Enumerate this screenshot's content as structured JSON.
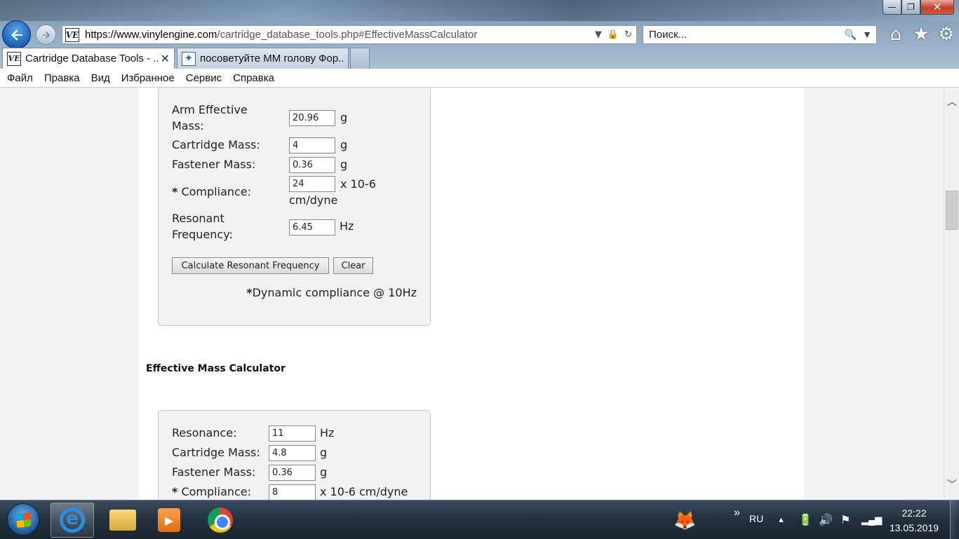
{
  "browser": {
    "url_host": "https://www.vinylengine.com",
    "url_path": "/cartridge_database_tools.php#EffectiveMassCalculator",
    "search_placeholder": "Поиск...",
    "tabs": [
      {
        "title": "Cartridge Database Tools - ..."
      },
      {
        "title": "посоветуйте ММ голову Фор..."
      }
    ],
    "menu": [
      "Файл",
      "Правка",
      "Вид",
      "Избранное",
      "Сервис",
      "Справка"
    ]
  },
  "resonance_calc": {
    "arm_mass_label": "Arm Effective Mass:",
    "arm_mass_value": "20.96",
    "arm_mass_unit": "g",
    "cart_mass_label": "Cartridge Mass:",
    "cart_mass_value": "4",
    "cart_mass_unit": "g",
    "fastener_label": "Fastener Mass:",
    "fastener_value": "0.36",
    "fastener_unit": "g",
    "compliance_label": "Compliance:",
    "compliance_value": "24",
    "compliance_unit": "x 10-6 cm/dyne",
    "resfreq_label": "Resonant Frequency:",
    "resfreq_value": "6.45",
    "resfreq_unit": "Hz",
    "calc_button": "Calculate Resonant Frequency",
    "clear_button": "Clear",
    "note": "Dynamic compliance @ 10Hz"
  },
  "effective_mass_title": "Effective Mass Calculator",
  "mass_calc": {
    "resonance_label": "Resonance:",
    "resonance_value": "11",
    "resonance_unit": "Hz",
    "cart_mass_label": "Cartridge Mass:",
    "cart_mass_value": "4.8",
    "cart_mass_unit": "g",
    "fastener_label": "Fastener Mass:",
    "fastener_value": "0.36",
    "fastener_unit": "g",
    "compliance_label": "Compliance:",
    "compliance_value": "8",
    "compliance_unit": "x 10-6 cm/dyne"
  },
  "taskbar": {
    "lang": "RU",
    "time": "22:22",
    "date": "13.05.2019"
  }
}
